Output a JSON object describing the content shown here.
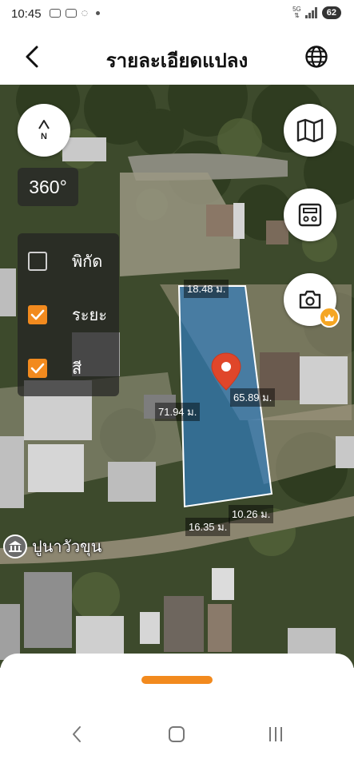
{
  "status": {
    "time": "10:45",
    "network": "5G",
    "battery": "62"
  },
  "header": {
    "title": "รายละเอียดแปลง"
  },
  "map": {
    "compass_label": "N",
    "rotation_label": "360°",
    "layers": [
      {
        "label": "พิกัด",
        "checked": false
      },
      {
        "label": "ระยะ",
        "checked": true
      },
      {
        "label": "สี",
        "checked": true
      }
    ],
    "dimensions": {
      "top": "18.48 ม.",
      "right": "65.89 ม.",
      "left": "71.94 ม.",
      "bottom_left": "16.35 ม.",
      "bottom_right": "10.26 ม."
    },
    "place_name": "ปูนาวัวขุน"
  },
  "colors": {
    "accent": "#f28a1e",
    "parcel_fill": "#2f7fc8",
    "pin": "#e0462a"
  }
}
